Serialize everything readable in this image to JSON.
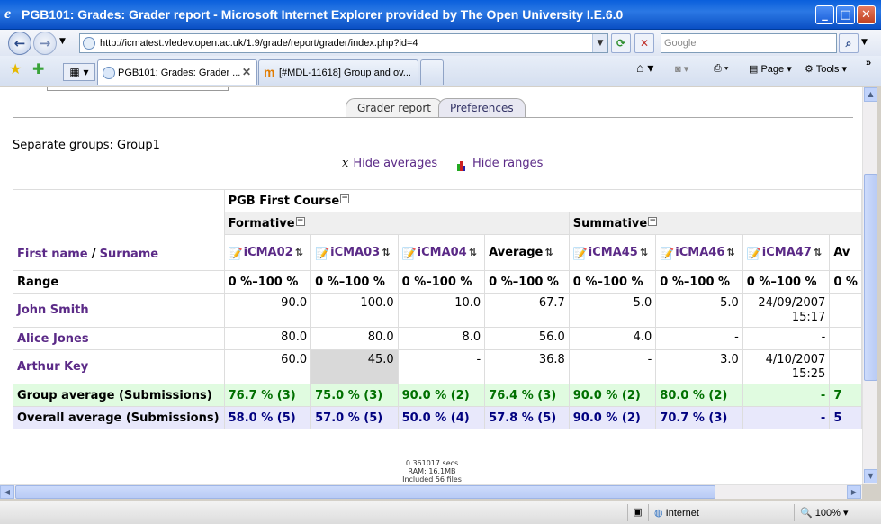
{
  "window": {
    "title": "PGB101: Grades: Grader report - Microsoft Internet Explorer provided by The Open University I.E.6.0"
  },
  "browser": {
    "url": "http://icmatest.vledev.open.ac.uk/1.9/grade/report/grader/index.php?id=4",
    "search_placeholder": "Google",
    "tabs": [
      {
        "label": "PGB101: Grades: Grader ..."
      },
      {
        "label": "[#MDL-11618] Group and ov..."
      }
    ],
    "commands": {
      "page": "Page",
      "tools": "Tools"
    },
    "status": {
      "zone": "Internet",
      "zoom": "100%"
    }
  },
  "report": {
    "tabs": [
      "Grader report",
      "Preferences"
    ],
    "groups_text": "Separate groups: Group1",
    "hide_averages": "Hide averages",
    "hide_ranges": "Hide ranges",
    "course_title": "PGB First Course",
    "categories": [
      "Formative",
      "Summative"
    ],
    "name_header": {
      "first": "First name",
      "sep": "/",
      "last": "Surname"
    },
    "columns": [
      "iCMA02",
      "iCMA03",
      "iCMA04",
      "Average",
      "iCMA45",
      "iCMA46",
      "iCMA47",
      "Av"
    ],
    "range_label": "Range",
    "range_values": [
      "0 %–100 %",
      "0 %–100 %",
      "0 %–100 %",
      "0 %–100 %",
      "0 %–100 %",
      "0 %–100 %",
      "0 %–100 %",
      "0 %"
    ],
    "students": [
      {
        "name": "John Smith",
        "grades": [
          "90.0",
          "100.0",
          "10.0",
          "67.7",
          "5.0",
          "5.0",
          "24/09/2007",
          ""
        ],
        "extra": "15:17"
      },
      {
        "name": "Alice Jones",
        "grades": [
          "80.0",
          "80.0",
          "8.0",
          "56.0",
          "4.0",
          "-",
          "-",
          ""
        ],
        "extra": ""
      },
      {
        "name": "Arthur Key",
        "grades": [
          "60.0",
          "45.0",
          "-",
          "36.8",
          "-",
          "3.0",
          "4/10/2007",
          ""
        ],
        "extra": "15:25"
      }
    ],
    "group_average": {
      "label": "Group average (Submissions)",
      "values": [
        "76.7 % (3)",
        "75.0 % (3)",
        "90.0 % (2)",
        "76.4 % (3)",
        "90.0 % (2)",
        "80.0 % (2)",
        "-",
        "7"
      ]
    },
    "overall_average": {
      "label": "Overall average (Submissions)",
      "values": [
        "58.0 % (5)",
        "57.0 % (5)",
        "50.0 % (4)",
        "57.8 % (5)",
        "90.0 % (2)",
        "70.7 % (3)",
        "-",
        "5"
      ]
    },
    "footer": {
      "time": "0.361017 secs",
      "ram": "RAM: 16.1MB",
      "files": "Included 56 files"
    }
  }
}
